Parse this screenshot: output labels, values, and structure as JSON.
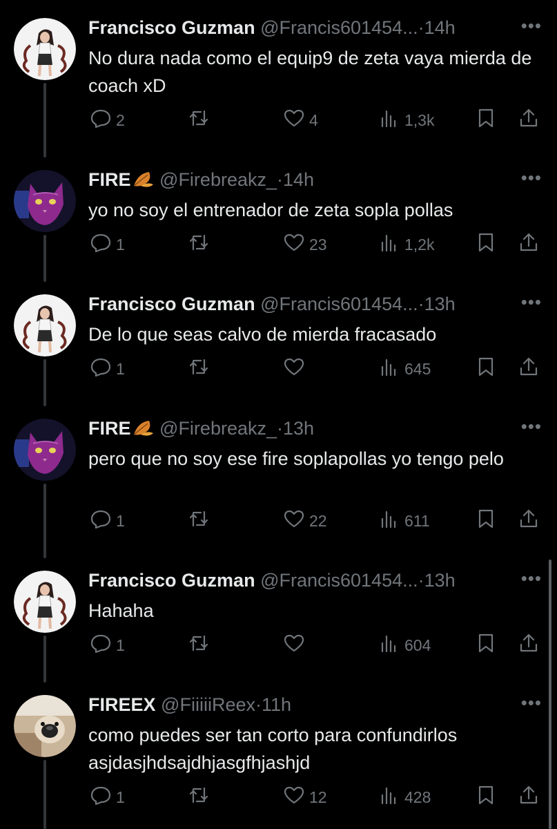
{
  "tweets": [
    {
      "name": "Francisco Guzman",
      "handle": "@Francis601454...",
      "dot": "·",
      "time": "14h",
      "text": "No dura nada como el equip9 de zeta vaya mierda de coach xD",
      "replies": "2",
      "retweets": "",
      "likes": "4",
      "views": "1,3k",
      "avatar": "girl-character"
    },
    {
      "name": "FIRE",
      "handle": "@Firebreakz_",
      "dot": "·",
      "time": "14h",
      "text": "yo no soy el entrenador de zeta sopla pollas",
      "replies": "1",
      "retweets": "",
      "likes": "23",
      "views": "1,2k",
      "avatar": "purple-cat"
    },
    {
      "name": "Francisco Guzman",
      "handle": "@Francis601454...",
      "dot": "·",
      "time": "13h",
      "text": "De lo que seas calvo de mierda fracasado",
      "replies": "1",
      "retweets": "",
      "likes": "",
      "views": "645",
      "avatar": "girl-character"
    },
    {
      "name": "FIRE",
      "handle": "@Firebreakz_",
      "dot": "·",
      "time": "13h",
      "text": "pero que no soy ese fire soplapollas yo tengo pelo",
      "replies": "1",
      "retweets": "",
      "likes": "22",
      "views": "611",
      "avatar": "purple-cat"
    },
    {
      "name": "Francisco Guzman",
      "handle": "@Francis601454...",
      "dot": "·",
      "time": "13h",
      "text": "Hahaha",
      "replies": "1",
      "retweets": "",
      "likes": "",
      "views": "604",
      "avatar": "girl-character"
    },
    {
      "name": "FIREEX",
      "handle": "@FiiiiiReex",
      "dot": "·",
      "time": "11h",
      "text": "como puedes ser tan corto para confundirlos asjdasjhdsajdhjasgfhjashjd",
      "replies": "1",
      "retweets": "",
      "likes": "12",
      "views": "428",
      "avatar": "pug-dog"
    }
  ],
  "more_label": "•••",
  "icons": {
    "reply": "reply-icon",
    "retweet": "retweet-icon",
    "like": "heart-icon",
    "views": "views-icon",
    "bookmark": "bookmark-icon",
    "share": "share-icon",
    "fire_emoji": "fallen-leaf-emoji"
  },
  "colors": {
    "background": "#000000",
    "text": "#e7e9ea",
    "muted": "#71767b",
    "thread_line": "#333639"
  }
}
